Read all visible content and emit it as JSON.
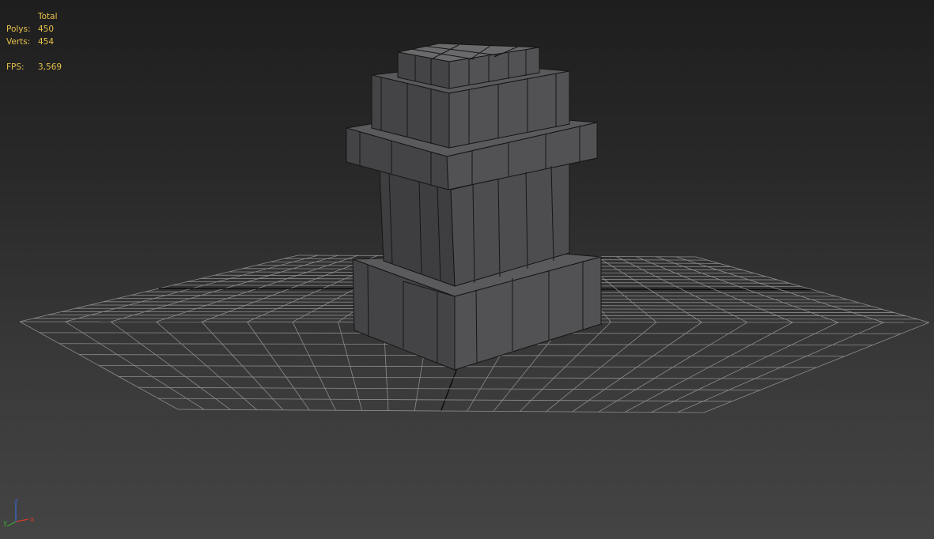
{
  "viewport": {
    "background": [
      "#1e1e1e",
      "#444444"
    ],
    "grid_color": "#8c8c8c",
    "home_grid_color": "#050505",
    "stats_color": "#e8c24a"
  },
  "stats": {
    "header": "Total",
    "polys_label": "Polys:",
    "polys_value": "450",
    "verts_label": "Verts:",
    "verts_value": "454",
    "fps_label": "FPS:",
    "fps_value": "3,569"
  },
  "model": {
    "name": "pedestal-object",
    "shading": "gray with edged faces",
    "color": "#4a4a4c"
  },
  "axis_gizmo": {
    "x_label": "x",
    "y_label": "y",
    "z_label": "z",
    "x_color": "#d23a2a",
    "y_color": "#3aa23a",
    "z_color": "#3a66d8"
  }
}
